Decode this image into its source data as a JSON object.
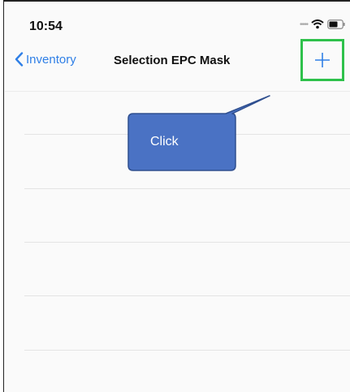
{
  "status_bar": {
    "time": "10:54",
    "signal_icon": "cellular-dots-icon",
    "wifi_icon": "wifi-icon",
    "battery_icon": "battery-icon"
  },
  "nav": {
    "back_label": "Inventory",
    "back_icon": "chevron-left-icon",
    "title": "Selection EPC Mask",
    "add_icon": "plus-icon"
  },
  "callout": {
    "text": "Click"
  },
  "colors": {
    "accent": "#2f7fe6",
    "highlight": "#2ec14b",
    "callout_fill": "#4a72c4",
    "callout_stroke": "#2f4f8f"
  }
}
